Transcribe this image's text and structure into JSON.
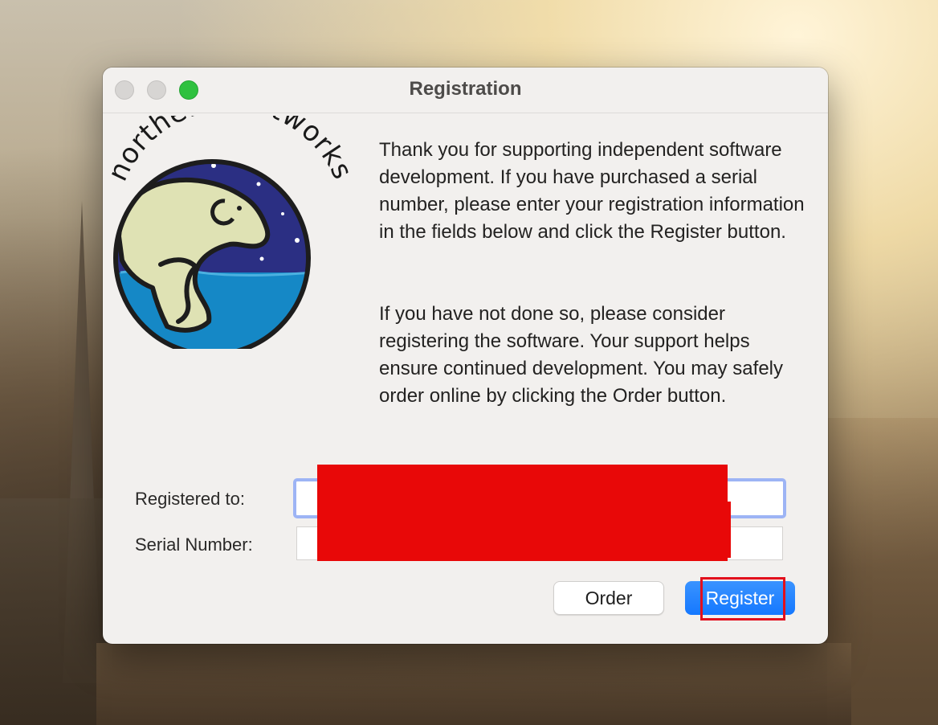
{
  "window": {
    "title": "Registration",
    "traffic_lights": [
      "close",
      "minimize",
      "zoom"
    ]
  },
  "logo": {
    "text": "northern softworks"
  },
  "body": {
    "paragraph1": "Thank you for supporting independent software development.  If you have purchased a serial number, please enter your registration information in the fields below and click the Register button.",
    "paragraph2": "If you have not done so, please consider registering the software.  Your support helps ensure continued development.  You may safely order online by clicking the Order button."
  },
  "form": {
    "registered_to_label": "Registered to:",
    "registered_to_value": "",
    "serial_number_label": "Serial Number:",
    "serial_number_value": ""
  },
  "buttons": {
    "order_label": "Order",
    "register_label": "Register"
  },
  "colors": {
    "accent": "#1578ff",
    "focus_ring": "#9db4f5",
    "redaction": "#e80808",
    "highlight": "#e2101c",
    "zoom_green": "#2fc13f"
  }
}
